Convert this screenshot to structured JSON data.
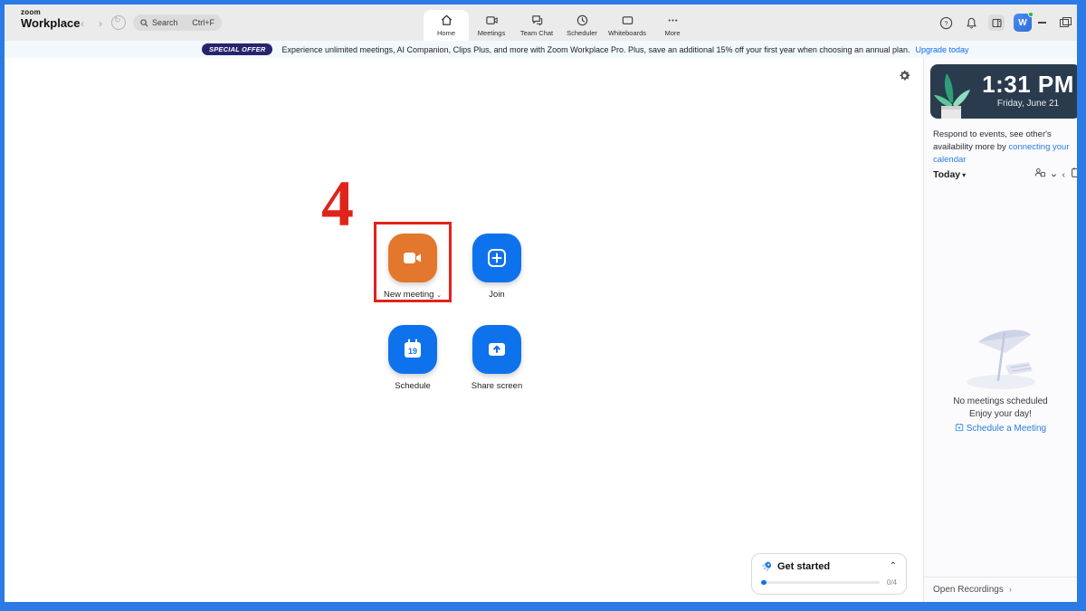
{
  "titlebar": {
    "logo_small": "zoom",
    "logo_main": "Workplace",
    "search_label": "Search",
    "search_shortcut": "Ctrl+F"
  },
  "tabs": [
    {
      "label": "Home",
      "active": true
    },
    {
      "label": "Meetings",
      "active": false
    },
    {
      "label": "Team Chat",
      "active": false
    },
    {
      "label": "Scheduler",
      "active": false
    },
    {
      "label": "Whiteboards",
      "active": false
    },
    {
      "label": "More",
      "active": false
    }
  ],
  "topright": {
    "avatar_initial": "W"
  },
  "banner": {
    "badge": "SPECIAL OFFER",
    "text": "Experience unlimited meetings, AI Companion, Clips Plus, and more with Zoom Workplace Pro. Plus, save an additional 15% off your first year when choosing an annual plan.",
    "link": "Upgrade today"
  },
  "annotation": {
    "number": "4"
  },
  "actions": {
    "new_meeting": {
      "label": "New meeting",
      "dropdown": "⌄"
    },
    "join": {
      "label": "Join"
    },
    "schedule": {
      "label": "Schedule",
      "day": "19"
    },
    "share_screen": {
      "label": "Share screen"
    }
  },
  "get_started": {
    "title": "Get started",
    "progress": "0/4"
  },
  "sidebar": {
    "clock": {
      "time": "1:31 PM",
      "date": "Friday, June 21"
    },
    "notice_text": "Respond to events, see other's availability more by ",
    "notice_link": "connecting your calendar",
    "today_label": "Today",
    "empty_line1": "No meetings scheduled",
    "empty_line2": "Enjoy your day!",
    "schedule_link": "Schedule a Meeting",
    "open_recordings": "Open Recordings"
  },
  "colors": {
    "accent_blue": "#0e72ed",
    "action_orange": "#e2772d",
    "annotation_red": "#e0241b",
    "badge_bg": "#26246e",
    "frame_blue": "#2b7ae5",
    "clock_card": "#2a3b4d"
  }
}
